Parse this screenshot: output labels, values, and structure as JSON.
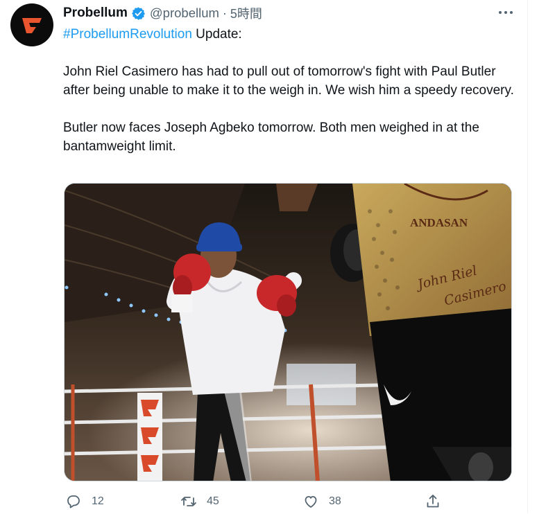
{
  "tweet": {
    "author_name": "Probellum",
    "handle": "@probellum",
    "separator": "·",
    "time": "5時間",
    "hashtag": "#ProbellumRevolution",
    "line1_rest": " Update:",
    "paragraph2": "John Riel Casimero has had to pull out of tomorrow's fight with Paul Butler after being unable to make it to the weigh in. We wish him a speedy recovery.",
    "paragraph3": "Butler now faces Joseph Agbeko tomorrow.  Both men weighed in at the bantamweight limit."
  },
  "media": {
    "shirt_text_1": "ANDASAN",
    "shirt_text_2": "John Riel",
    "shirt_text_3": "Casimero"
  },
  "actions": {
    "reply_count": "12",
    "retweet_count": "45",
    "like_count": "38"
  },
  "colors": {
    "brand_orange": "#e8552f",
    "link_blue": "#1d9bf0",
    "muted_gray": "#536471",
    "verified_blue": "#1d9bf0"
  },
  "icons": [
    "probellum-logo-icon",
    "verified-badge-icon",
    "more-icon",
    "reply-icon",
    "retweet-icon",
    "like-icon",
    "share-icon"
  ]
}
